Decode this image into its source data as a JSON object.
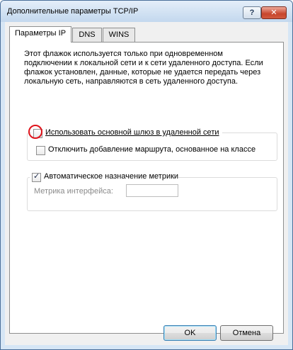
{
  "window": {
    "title": "Дополнительные параметры TCP/IP",
    "help_glyph": "?",
    "close_glyph": "✕"
  },
  "tabs": [
    {
      "label": "Параметры IP",
      "active": true
    },
    {
      "label": "DNS",
      "active": false
    },
    {
      "label": "WINS",
      "active": false
    }
  ],
  "description": {
    "lines": [
      "Этот флажок используется только при одновременном",
      "подключении к локальной сети и к сети удаленного доступа. Если",
      "флажок установлен, данные, которые не удается передать через",
      "локальную сеть, направляются в сеть удаленного доступа."
    ]
  },
  "options": {
    "use_default_gateway": {
      "label": "Использовать основной шлюз в удаленной сети",
      "checked": false
    },
    "disable_class_route": {
      "label": "Отключить добавление маршрута, основанное на классе",
      "checked": false
    },
    "automatic_metric": {
      "label": "Автоматическое назначение метрики",
      "checked": true
    }
  },
  "metric": {
    "label": "Метрика интерфейса:",
    "value": ""
  },
  "buttons": {
    "ok": "OK",
    "cancel": "Отмена"
  },
  "colors": {
    "highlight_circle": "#e0141c",
    "window_border": "#4b6f9a"
  }
}
